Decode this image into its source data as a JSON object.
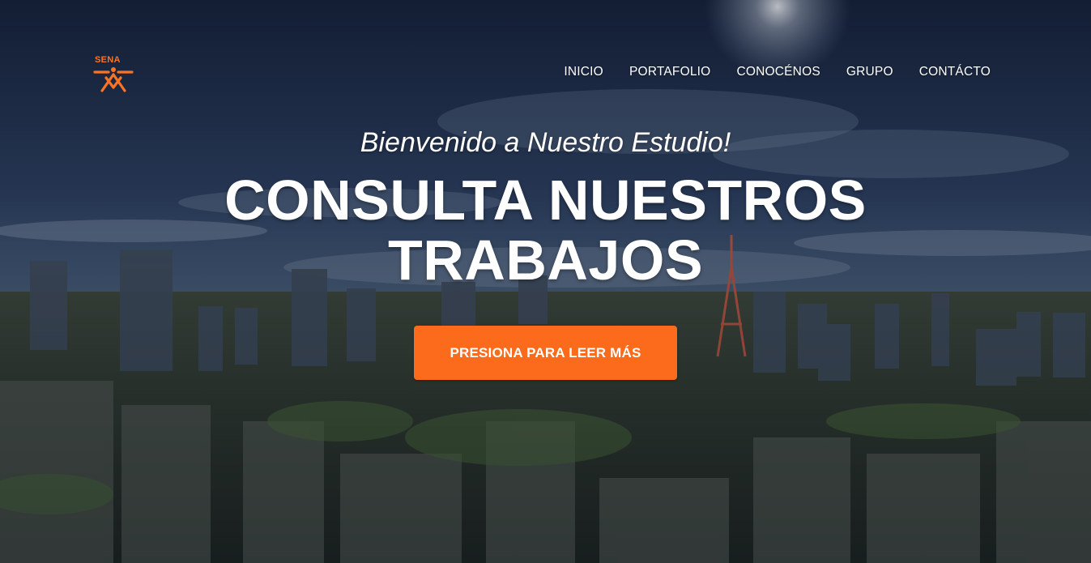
{
  "brand": {
    "logo_text": "SENA",
    "logo_color": "#fc7323"
  },
  "nav": {
    "items": [
      {
        "label": "INICIO"
      },
      {
        "label": "PORTAFOLIO"
      },
      {
        "label": "CONOCÉNOS"
      },
      {
        "label": "GRUPO"
      },
      {
        "label": "CONTÁCTO"
      }
    ]
  },
  "masthead": {
    "subheading": "Bienvenido a Nuestro Estudio!",
    "heading": "CONSULTA NUESTROS TRABAJOS",
    "cta_label": "PRESIONA PARA LEER MÁS",
    "cta_color": "#fc6a1b"
  },
  "background": {
    "icon": "city-skyline-image",
    "sky_color": "#2a3a57",
    "city_color": "#2b3326"
  }
}
